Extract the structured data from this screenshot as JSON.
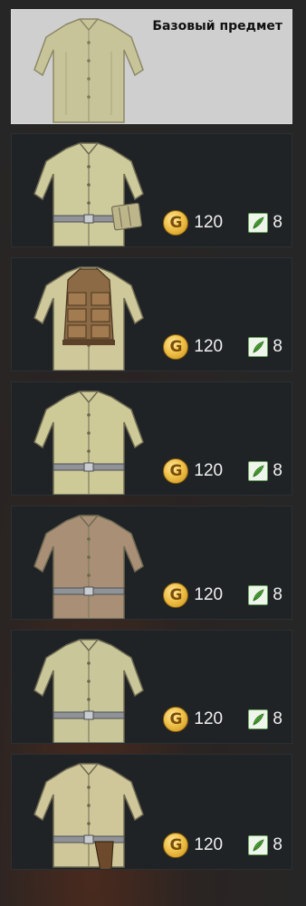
{
  "base": {
    "title": "Базовый предмет",
    "image": "olive-tunic-icon"
  },
  "variants": [
    {
      "image": "tunic-with-pouch-icon",
      "coin_price": "120",
      "leaf_price": "8",
      "cloth": "#cdca9c",
      "belt": true,
      "extra": "pouch"
    },
    {
      "image": "tunic-with-vest-icon",
      "coin_price": "120",
      "leaf_price": "8",
      "cloth": "#cfc89a",
      "belt": false,
      "extra": "vest"
    },
    {
      "image": "tunic-with-belt-icon",
      "coin_price": "120",
      "leaf_price": "8",
      "cloth": "#cdca98",
      "belt": true,
      "extra": "none"
    },
    {
      "image": "brown-tunic-icon",
      "coin_price": "120",
      "leaf_price": "8",
      "cloth": "#a98f76",
      "belt": true,
      "extra": "none"
    },
    {
      "image": "pale-tunic-icon",
      "coin_price": "120",
      "leaf_price": "8",
      "cloth": "#c9c79a",
      "belt": true,
      "extra": "none"
    },
    {
      "image": "tunic-with-holster-icon",
      "coin_price": "120",
      "leaf_price": "8",
      "cloth": "#cfc79a",
      "belt": true,
      "extra": "holster"
    }
  ],
  "icons": {
    "coin": "gold-coin-icon",
    "currency2": "green-leaf-icon"
  },
  "coin_letter": "G"
}
